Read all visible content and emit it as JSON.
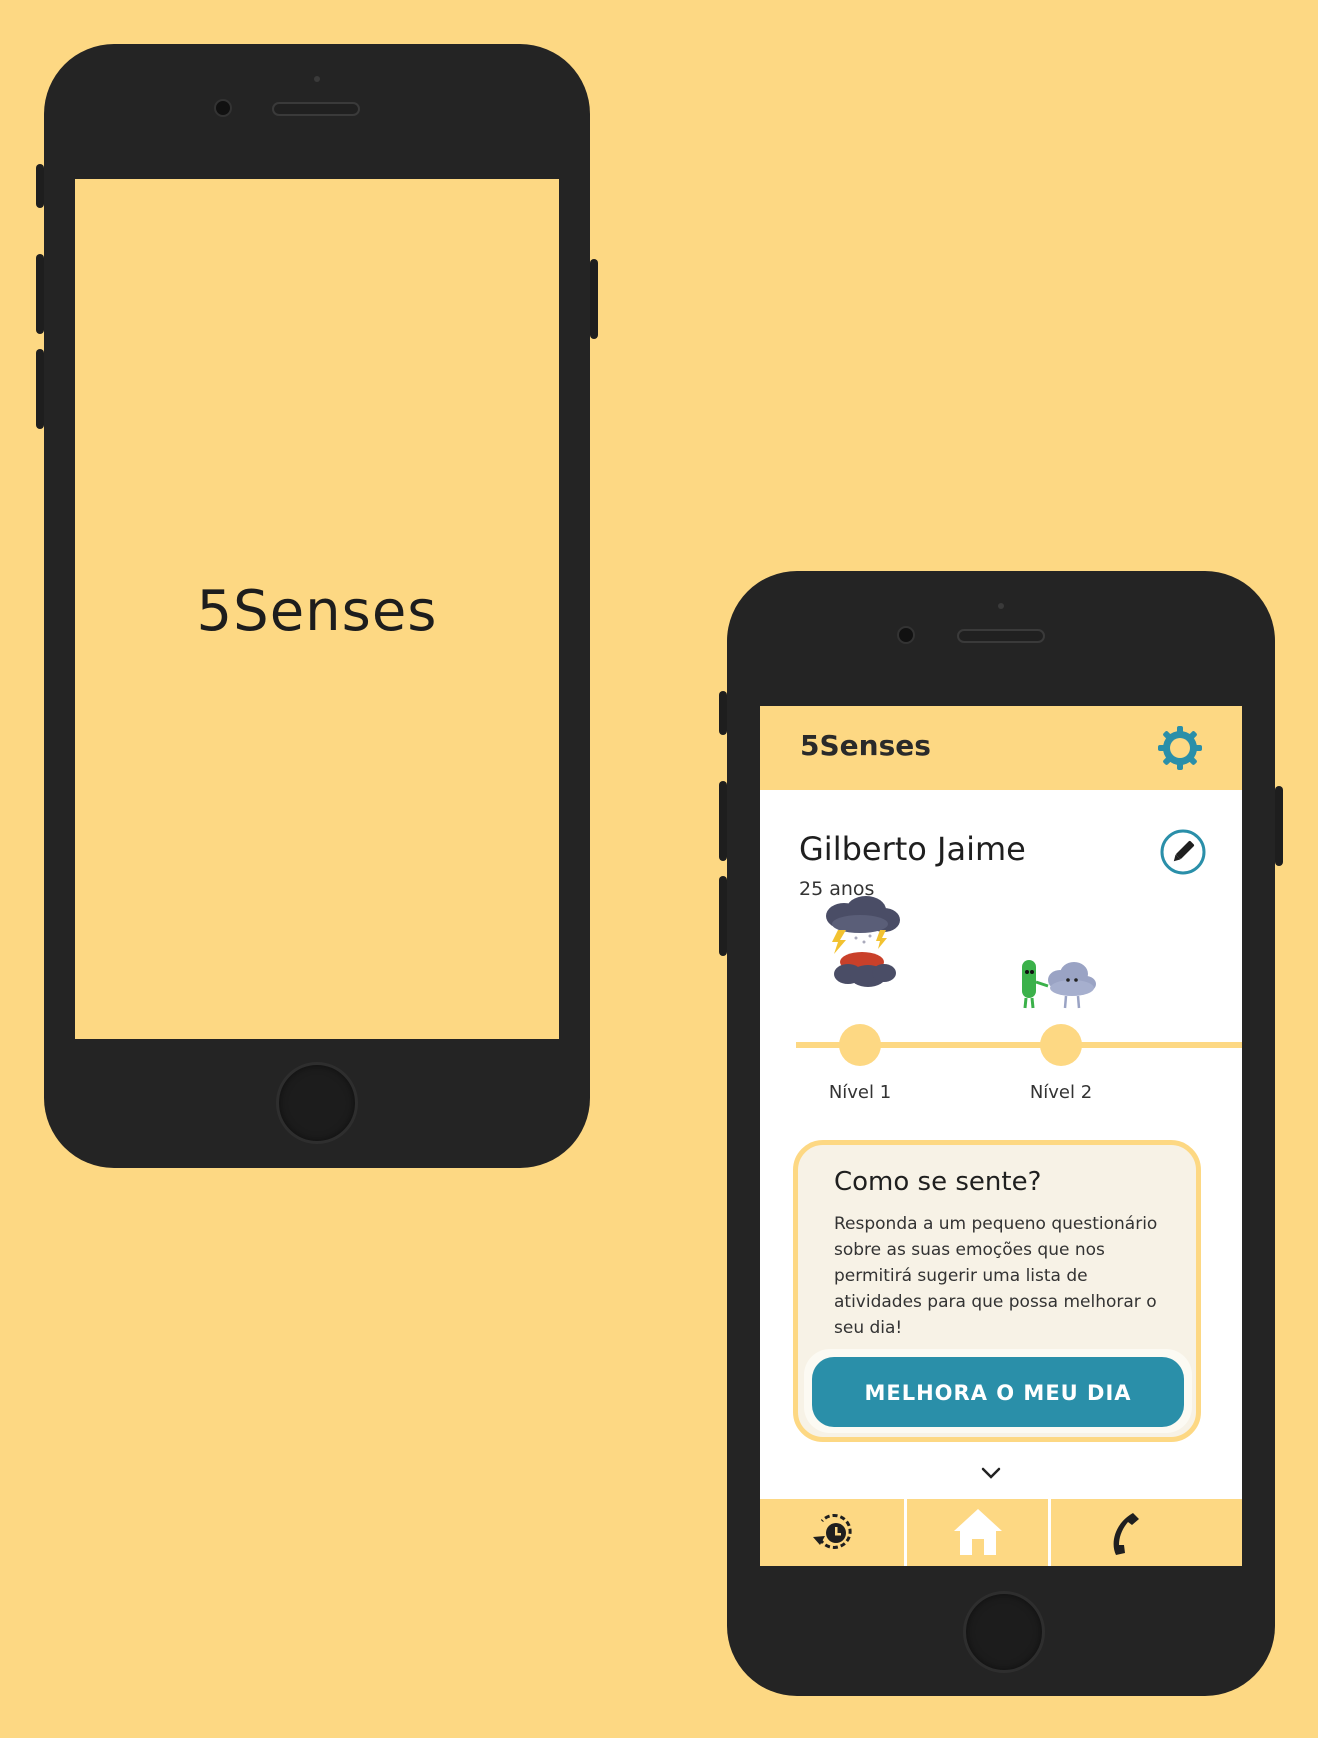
{
  "splash": {
    "title": "5Senses"
  },
  "app": {
    "title": "5Senses",
    "user": {
      "name": "Gilberto Jaime",
      "age": "25 anos"
    },
    "levels": [
      {
        "label": "Nível 1"
      },
      {
        "label": "Nível 2"
      }
    ],
    "card": {
      "title": "Como se sente?",
      "text": "Responda a um pequeno questionário sobre as suas emoções que nos permitirá sugerir uma lista de atividades para que possa melhorar o seu dia!",
      "button_label": "MELHORA O MEU DIA"
    },
    "nav": {
      "items": [
        {
          "icon": "history-icon"
        },
        {
          "icon": "home-icon"
        },
        {
          "icon": "phone-icon"
        }
      ]
    }
  },
  "colors": {
    "background": "#fdd883",
    "accent": "#2a8fa9",
    "card": "#f7f2e6",
    "phone": "#242424"
  }
}
